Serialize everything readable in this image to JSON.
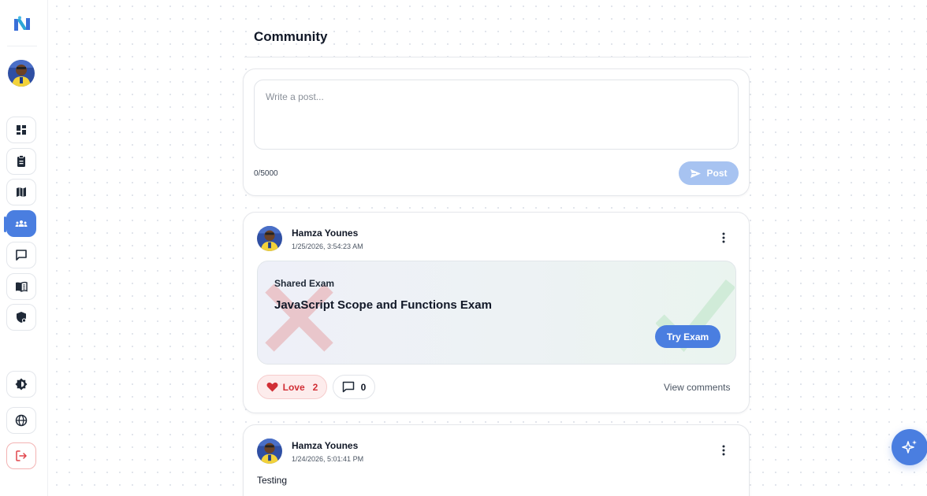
{
  "page": {
    "title": "Community"
  },
  "sidebar": {
    "items": [
      {
        "name": "dashboard",
        "icon": "dashboard-icon"
      },
      {
        "name": "exams",
        "icon": "clipboard-icon"
      },
      {
        "name": "roadmap",
        "icon": "map-icon"
      },
      {
        "name": "community",
        "icon": "community-icon",
        "active": true
      },
      {
        "name": "chat",
        "icon": "chat-icon"
      },
      {
        "name": "library",
        "icon": "book-icon"
      },
      {
        "name": "security",
        "icon": "shield-icon"
      }
    ],
    "bottom": [
      {
        "name": "theme",
        "icon": "theme-toggle-icon"
      },
      {
        "name": "language",
        "icon": "globe-icon"
      },
      {
        "name": "logout",
        "icon": "logout-icon"
      }
    ]
  },
  "composer": {
    "placeholder": "Write a post...",
    "char_count": "0/5000",
    "post_label": "Post"
  },
  "posts": [
    {
      "author": "Hamza Younes",
      "timestamp": "1/25/2026, 3:54:23 AM",
      "shared_label": "Shared Exam",
      "exam_title": "JavaScript Scope and Functions Exam",
      "try_label": "Try Exam",
      "love_label": "Love",
      "love_count": "2",
      "comment_count": "0",
      "view_comments_label": "View comments"
    },
    {
      "author": "Hamza Younes",
      "timestamp": "1/24/2026, 5:01:41 PM",
      "text": "Testing"
    }
  ],
  "colors": {
    "accent": "#4a7ee0",
    "accent_light": "#a7c3f1",
    "love": "#d12f36",
    "love_bg": "#fdecec"
  }
}
